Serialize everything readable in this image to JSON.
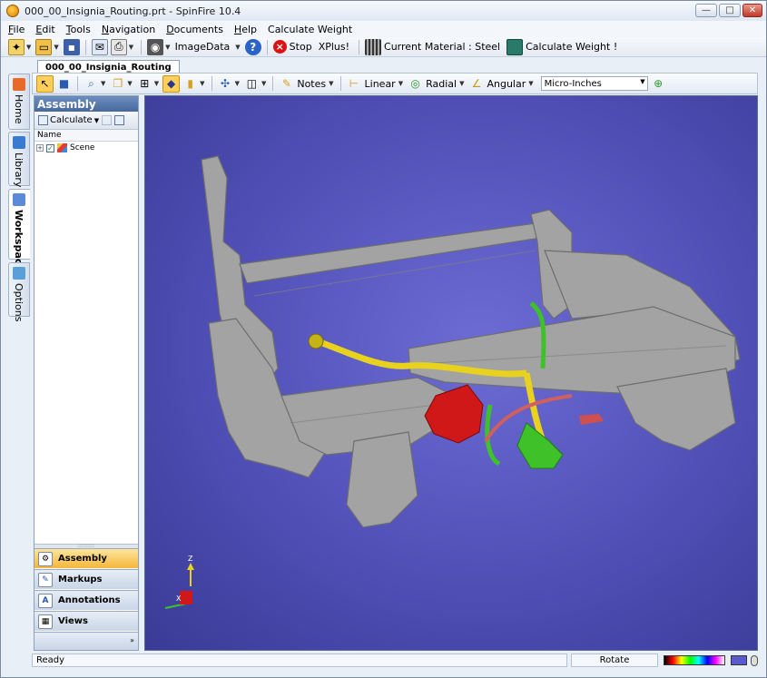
{
  "window": {
    "title": "000_00_Insignia_Routing.prt - SpinFire 10.4",
    "controls": {
      "minimize": "—",
      "maximize": "□",
      "close": "✕"
    }
  },
  "menu": {
    "items": [
      {
        "pre": "",
        "key": "F",
        "post": "ile"
      },
      {
        "pre": "",
        "key": "E",
        "post": "dit"
      },
      {
        "pre": "",
        "key": "T",
        "post": "ools"
      },
      {
        "pre": "",
        "key": "N",
        "post": "avigation"
      },
      {
        "pre": "",
        "key": "D",
        "post": "ocuments"
      },
      {
        "pre": "",
        "key": "H",
        "post": "elp"
      },
      {
        "pre": "Calculate Weight",
        "key": "",
        "post": ""
      }
    ]
  },
  "toolbar": {
    "imagedata_label": "ImageData",
    "stop_label": "Stop",
    "xplus_label": "XPlus!",
    "material_label": "Current Material : Steel",
    "calc_weight_label": "Calculate Weight !"
  },
  "vtabs": {
    "home": "Home",
    "library": "Library",
    "workspace": "Workspace",
    "options": "Options"
  },
  "document": {
    "tab_label": "000_00_Insignia_Routing"
  },
  "viewbar": {
    "notes_label": "Notes",
    "linear_label": "Linear",
    "radial_label": "Radial",
    "angular_label": "Angular",
    "units_value": "Micro-Inches"
  },
  "panel": {
    "title": "Assembly",
    "calculate_label": "Calculate",
    "column_name": "Name",
    "tree": [
      {
        "label": "Scene",
        "checked": true
      }
    ],
    "nav": {
      "assembly": "Assembly",
      "markups": "Markups",
      "annotations": "Annotations",
      "views": "Views"
    },
    "footer": "»"
  },
  "viewport": {
    "triad": {
      "z_label": "Z",
      "x_label": "X"
    }
  },
  "status": {
    "ready": "Ready",
    "mode": "Rotate"
  },
  "colors": {
    "viewport_bg": "#5555c0",
    "frame": "#9a9a9a",
    "routing_yellow": "#e8d21e",
    "routing_green": "#3fc12a",
    "component_red": "#d01818",
    "active_nav": "#f5b73c"
  }
}
